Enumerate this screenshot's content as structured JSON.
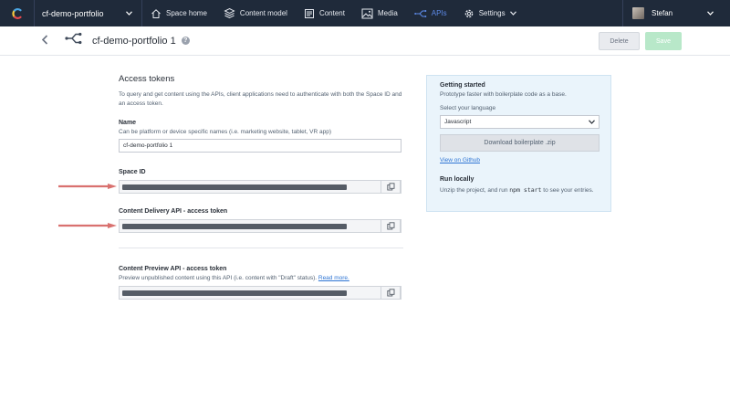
{
  "topnav": {
    "space_name": "cf-demo-portfolio",
    "items": [
      {
        "label": "Space home",
        "icon": "home-icon"
      },
      {
        "label": "Content model",
        "icon": "content-model-icon"
      },
      {
        "label": "Content",
        "icon": "content-icon"
      },
      {
        "label": "Media",
        "icon": "media-icon"
      },
      {
        "label": "APIs",
        "icon": "api-icon"
      },
      {
        "label": "Settings",
        "icon": "gear-icon"
      }
    ],
    "active_item": "APIs",
    "user_name": "Stefan"
  },
  "subheader": {
    "title": "cf-demo-portfolio 1",
    "delete_label": "Delete",
    "save_label": "Save"
  },
  "access_tokens": {
    "title": "Access tokens",
    "intro": "To query and get content using the APIs, client applications need to authenticate with both the Space ID and an access token.",
    "name_label": "Name",
    "name_help": "Can be platform or device specific names (i.e. marketing website, tablet, VR app)",
    "name_value": "cf-demo-portfolio 1",
    "space_id_label": "Space ID",
    "cda_label": "Content Delivery API - access token",
    "cpa_label": "Content Preview API - access token",
    "cpa_help": "Preview unpublished content using this API (i.e. content with \"Draft\" status).",
    "cpa_help_link": "Read more."
  },
  "getting_started": {
    "title": "Getting started",
    "subtitle": "Prototype faster with boilerplate code as a base.",
    "language_label": "Select your language",
    "language_value": "Javascript",
    "download_label": "Download boilerplate .zip",
    "github_link": "View on Github",
    "run_title": "Run locally",
    "run_text_before": "Unzip the project, and run ",
    "run_code": "npm start",
    "run_text_after": " to see your entries."
  },
  "colors": {
    "nav_bg": "#1f2a3a",
    "active_nav": "#5d8ae8",
    "link": "#2e75d4",
    "annotation_arrow": "#d9716f",
    "save_button": "#b8e8c9",
    "side_panel_bg": "#eaf4fb"
  }
}
